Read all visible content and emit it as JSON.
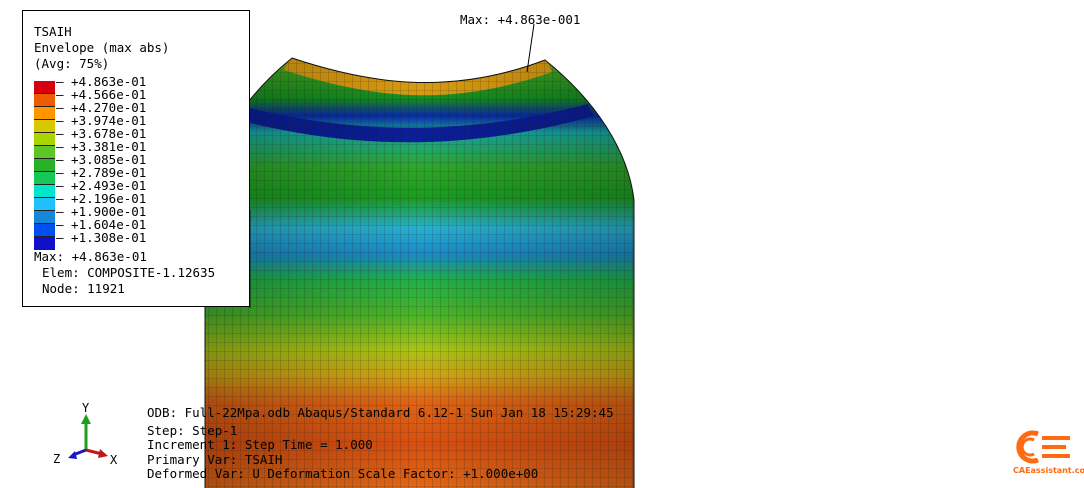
{
  "legend": {
    "variable": "TSAIH",
    "line2": "Envelope (max abs)",
    "line3": "(Avg: 75%)",
    "colors": [
      "#d7000f",
      "#f05a00",
      "#ff9600",
      "#d7c800",
      "#a8d400",
      "#5cc626",
      "#28b028",
      "#16c858",
      "#00e6c8",
      "#20c0ff",
      "#1488d8",
      "#0050f0",
      "#1010c8"
    ],
    "ticks": [
      "+4.863e-01",
      "+4.566e-01",
      "+4.270e-01",
      "+3.974e-01",
      "+3.678e-01",
      "+3.381e-01",
      "+3.085e-01",
      "+2.789e-01",
      "+2.493e-01",
      "+2.196e-01",
      "+1.900e-01",
      "+1.604e-01",
      "+1.308e-01"
    ],
    "max_line": "Max: +4.863e-01",
    "elem_line": "Elem: COMPOSITE-1.12635",
    "node_line": "Node: 11921"
  },
  "viewport": {
    "max_callout": "Max: +4.863e-001"
  },
  "status": {
    "odb": "ODB: Full-22Mpa.odb   Abaqus/Standard 6.12-1   Sun Jan 18 15:29:45",
    "step": "Step: Step-1",
    "increment": "Increment    1: Step Time =    1.000",
    "primary": "Primary Var: TSAIH",
    "deformed": "Deformed Var: U  Deformation Scale Factor: +1.000e+00"
  },
  "triad": {
    "x": "X",
    "y": "Y",
    "z": "Z"
  },
  "logo": {
    "text": "CAEassistant.com",
    "color": "#ff6a13"
  }
}
